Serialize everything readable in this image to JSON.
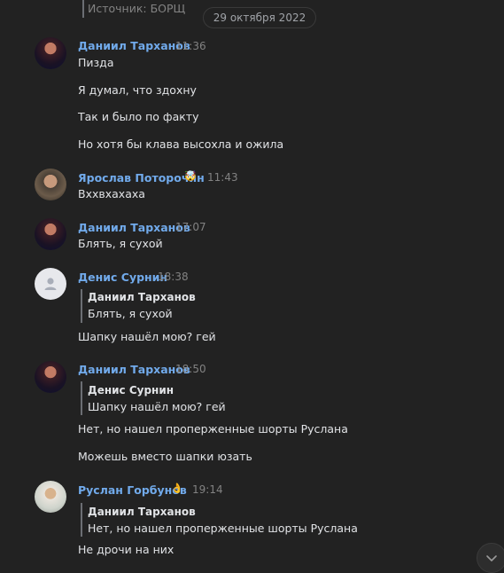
{
  "top": {
    "source_text": "Источник: БОРЩ",
    "date": "29 октября 2022"
  },
  "messages": [
    {
      "author": "Даниил Тарханов",
      "time": "11:36",
      "lines": [
        "Пизда",
        "Я думал, что здохну",
        "Так и было по факту",
        "Но хотя бы клава высохла и ожила"
      ]
    },
    {
      "author": "Ярослав Поторочин",
      "badge": "🤯",
      "time": "11:43",
      "lines": [
        "Вхxвхахаха"
      ]
    },
    {
      "author": "Даниил Тарханов",
      "time": "17:07",
      "lines": [
        "Блять, я сухой"
      ]
    },
    {
      "author": "Денис Сурнин",
      "time": "18:38",
      "reply": {
        "author": "Даниил Тарханов",
        "text": "Блять, я сухой"
      },
      "lines": [
        "Шапку нашёл мою? гей"
      ]
    },
    {
      "author": "Даниил Тарханов",
      "time": "18:50",
      "reply": {
        "author": "Денис Сурнин",
        "text": "Шапку нашёл мою? гей"
      },
      "lines": [
        "Нет, но нашел проперженные шорты Руслана",
        "Можешь вместо шапки юзать"
      ]
    },
    {
      "author": "Руслан Горбунов",
      "badge": "👌",
      "time": "19:14",
      "reply": {
        "author": "Даниил Тарханов",
        "text": "Нет, но нашел проперженные шорты Руслана"
      },
      "lines": [
        "Не дрочи на них"
      ]
    }
  ],
  "icons": {
    "scroll_down": "chevron-down-icon",
    "default_avatar": "user-icon"
  }
}
